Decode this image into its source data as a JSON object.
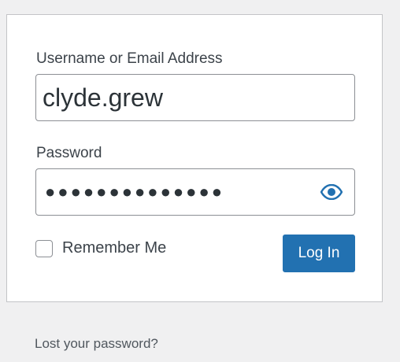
{
  "login_form": {
    "username_label": "Username or Email Address",
    "username_value": "clyde.grew",
    "password_label": "Password",
    "password_masked": "●●●●●●●●●●●●●●",
    "show_password_icon": "eye-icon",
    "remember_label": "Remember Me",
    "remember_checked": false,
    "submit_label": "Log In"
  },
  "links": {
    "lost_password": "Lost your password?"
  },
  "colors": {
    "page_background": "#f0f0f1",
    "primary_button": "#2271b1",
    "eye_icon": "#2271b1",
    "text": "#3c434a"
  }
}
